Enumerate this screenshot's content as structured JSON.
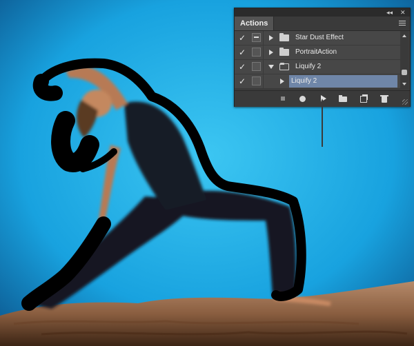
{
  "panel": {
    "collapse_glyph": "◂◂",
    "close_glyph": "✕",
    "tab_title": "Actions",
    "menu_icon": "panel-menu-icon"
  },
  "actions": [
    {
      "checked": true,
      "dialog": true,
      "expanded": false,
      "type": "set",
      "label": "Star Dust Effect"
    },
    {
      "checked": true,
      "dialog": false,
      "expanded": false,
      "type": "set",
      "label": "PortraitAction"
    },
    {
      "checked": true,
      "dialog": false,
      "expanded": true,
      "type": "set",
      "label": "Liquify 2"
    },
    {
      "checked": true,
      "dialog": false,
      "expanded": false,
      "type": "action",
      "label": "Liquify 2",
      "selected": true
    }
  ],
  "check_glyph": "✓",
  "toolbar": {
    "buttons": [
      "stop-icon",
      "record-icon",
      "play-icon",
      "new-set-icon",
      "new-action-icon",
      "trash-icon"
    ]
  },
  "colors": {
    "sky": "#1aa3e0",
    "panel_bg": "#3c3c3c",
    "selection": "#6f86a8"
  }
}
